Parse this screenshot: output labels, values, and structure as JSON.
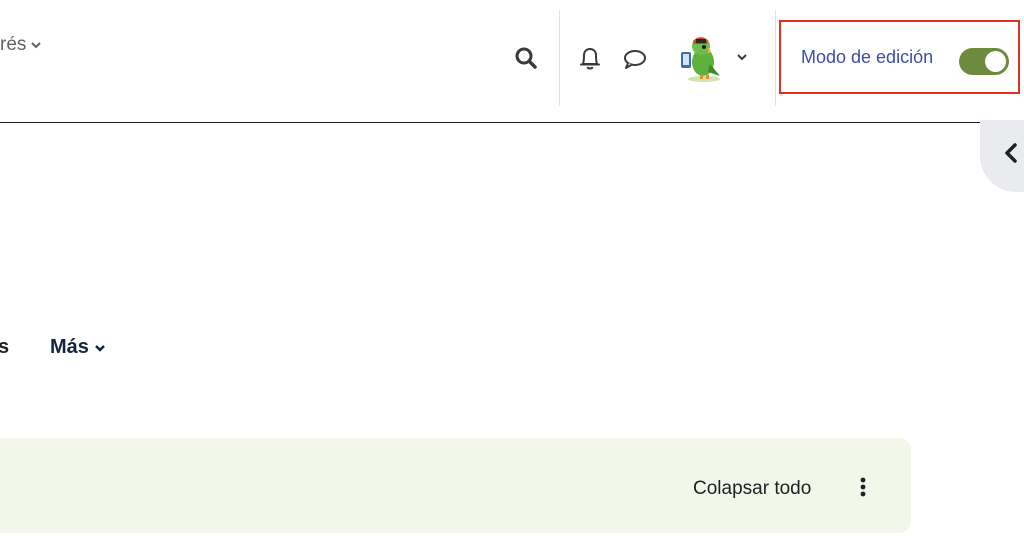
{
  "header": {
    "language_menu_label": "rés",
    "edit_mode_label": "Modo de edición",
    "edit_mode_on": true
  },
  "icons": {
    "search": "search-icon",
    "notifications": "bell-icon",
    "messages": "chat-bubble-icon",
    "user_avatar": "parrot-avatar",
    "drawer_toggle": "chevron-left-icon",
    "actions_menu": "kebab-icon"
  },
  "secondary_nav": {
    "partial_item": "s",
    "more_label": "Más"
  },
  "course": {
    "collapse_all_label": "Colapsar todo"
  },
  "colors": {
    "edit_mode_link": "#3d4ea8",
    "toggle_on": "#6e8b3d",
    "highlight_border": "#e0301e",
    "course_bar_bg": "#f3f7e9"
  }
}
